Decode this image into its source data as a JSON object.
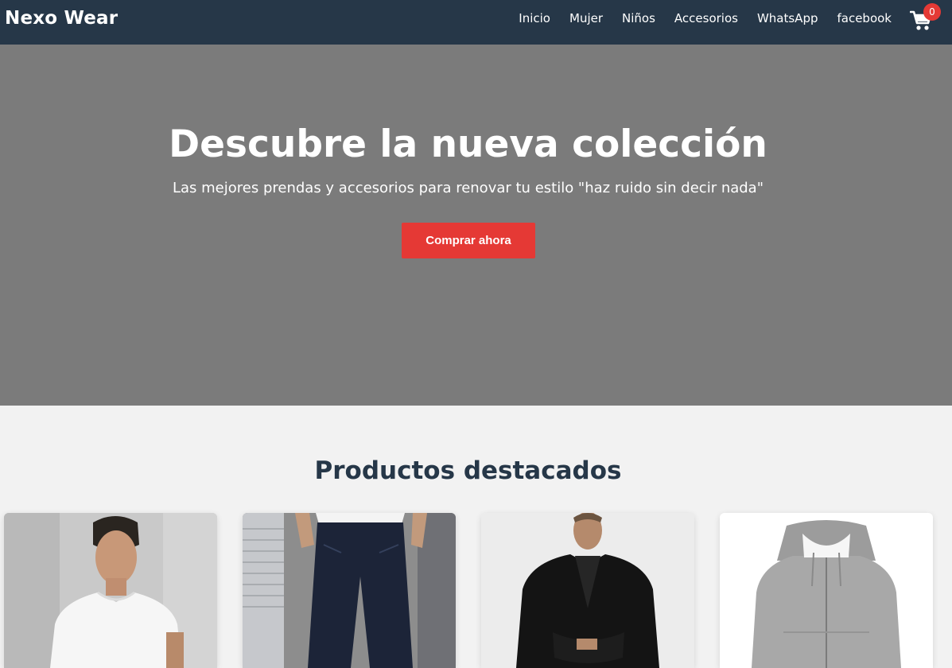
{
  "brand": "Nexo Wear",
  "nav": {
    "items": [
      {
        "label": "Inicio"
      },
      {
        "label": "Mujer"
      },
      {
        "label": "Niños"
      },
      {
        "label": "Accesorios"
      },
      {
        "label": "WhatsApp"
      },
      {
        "label": "facebook"
      }
    ],
    "cart_icon": "shopping-cart-icon",
    "cart_count": "0"
  },
  "hero": {
    "title": "Descubre la nueva colección",
    "subtitle": "Las mejores prendas y accesorios para renovar tu estilo \"haz ruido sin decir nada\"",
    "cta_label": "Comprar ahora"
  },
  "featured": {
    "title": "Productos destacados",
    "products": [
      {
        "image": "white-t-shirt-photo"
      },
      {
        "image": "dark-jeans-photo"
      },
      {
        "image": "black-blazer-photo"
      },
      {
        "image": "grey-hoodie-photo"
      }
    ]
  },
  "colors": {
    "navbar": "#263748",
    "hero_bg": "#7b7b7b",
    "accent": "#e53935",
    "page_bg": "#f2f2f2"
  }
}
